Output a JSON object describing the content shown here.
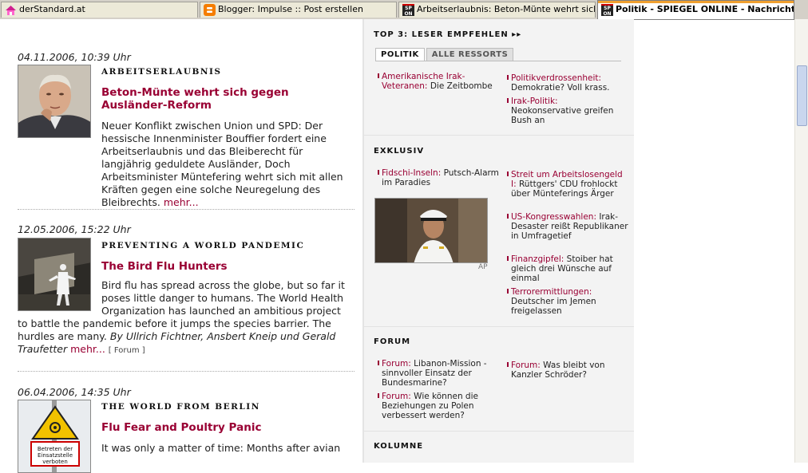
{
  "tabs": [
    {
      "title": "derStandard.at",
      "icon": "house-icon"
    },
    {
      "title": "Blogger: Impulse :: Post erstellen",
      "icon": "blogger-icon"
    },
    {
      "title": "Arbeitserlaubnis: Beton-Münte wehrt sich g...",
      "icon": "spon-icon"
    },
    {
      "title": "Politik - SPIEGEL ONLINE - Nachrichten",
      "icon": "spon-icon",
      "active": true
    }
  ],
  "spon_logo": {
    "line1": "SP",
    "line2": "ON"
  },
  "articles": [
    {
      "date": "04.11.2006, 10:39 Uhr",
      "kicker": "ARBEITSERLAUBNIS",
      "headline": "Beton-Münte wehrt sich gegen Ausländer-Reform",
      "body": "Neuer Konflikt zwischen Union und SPD: Der hessische Innenminister Bouffier fordert eine Arbeitserlaubnis und das Bleiberecht für langjährig geduldete Ausländer, Doch Arbeitsminister Müntefering wehrt sich mit allen Kräften gegen eine solche Neuregelung des Bleibrechts.",
      "more": "mehr...",
      "image": "politician-portrait"
    },
    {
      "date": "12.05.2006, 15:22 Uhr",
      "kicker": "PREVENTING A WORLD PANDEMIC",
      "headline": "The Bird Flu Hunters",
      "body": "Bird flu has spread across the globe, but so far it poses little danger to humans. The World Health Organization has launched an ambitious project to battle the pandemic before it jumps the species barrier. The hurdles are many.",
      "author": "By Ullrich Fichtner, Ansbert Kneip und Gerald Traufetter",
      "more": "mehr...",
      "forum": "[ Forum ]",
      "image": "protective-suit-worker"
    },
    {
      "date": "06.04.2006, 14:35 Uhr",
      "kicker": "THE WORLD FROM BERLIN",
      "headline": "Flu Fear and Poultry Panic",
      "body": "It was only a matter of time: Months after avian",
      "image": "biohazard-sign",
      "sign_text": "Betreten der Einsatzstelle verboten"
    }
  ],
  "sidebar": {
    "top3": {
      "title": "TOP 3: LESER EMPFEHLEN ▸▸",
      "tabs": [
        "POLITIK",
        "ALLE RESSORTS"
      ],
      "items": [
        {
          "kicker": "Amerikanische Irak-Veteranen:",
          "text": "Die Zeitbombe"
        },
        {
          "kicker": "Politikverdrossenheit:",
          "text": "Demokratie? Voll krass."
        },
        {
          "kicker": "Irak-Politik:",
          "text": "Neokonservative greifen Bush an"
        }
      ]
    },
    "exklusiv": {
      "title": "EXKLUSIV",
      "left_item": {
        "kicker": "Fidschi-Inseln:",
        "text": "Putsch-Alarm im Paradies"
      },
      "photo_credit": "AP",
      "items": [
        {
          "kicker": "Streit um Arbeitslosengeld I:",
          "text": "Rüttgers' CDU frohlockt über Münteferings Ärger"
        },
        {
          "kicker": "US-Kongresswahlen:",
          "text": "Irak-Desaster reißt Republikaner in Umfragetief"
        },
        {
          "kicker": "Finanzgipfel:",
          "text": "Stoiber hat gleich drei Wünsche auf einmal"
        },
        {
          "kicker": "Terrorermittlungen:",
          "text": "Deutscher im Jemen freigelassen"
        }
      ]
    },
    "forum": {
      "title": "FORUM",
      "items": [
        {
          "kicker": "Forum:",
          "text": "Libanon-Mission - sinnvoller Einsatz der Bundesmarine?"
        },
        {
          "kicker": "Forum:",
          "text": "Was bleibt von Kanzler Schröder?"
        },
        {
          "kicker": "Forum:",
          "text": "Wie können die Beziehungen zu Polen verbessert werden?"
        }
      ]
    },
    "kolumne": {
      "title": "KOLUMNE"
    }
  },
  "colors": {
    "accent": "#990033",
    "sidebar_bg": "#f3f3f3"
  }
}
